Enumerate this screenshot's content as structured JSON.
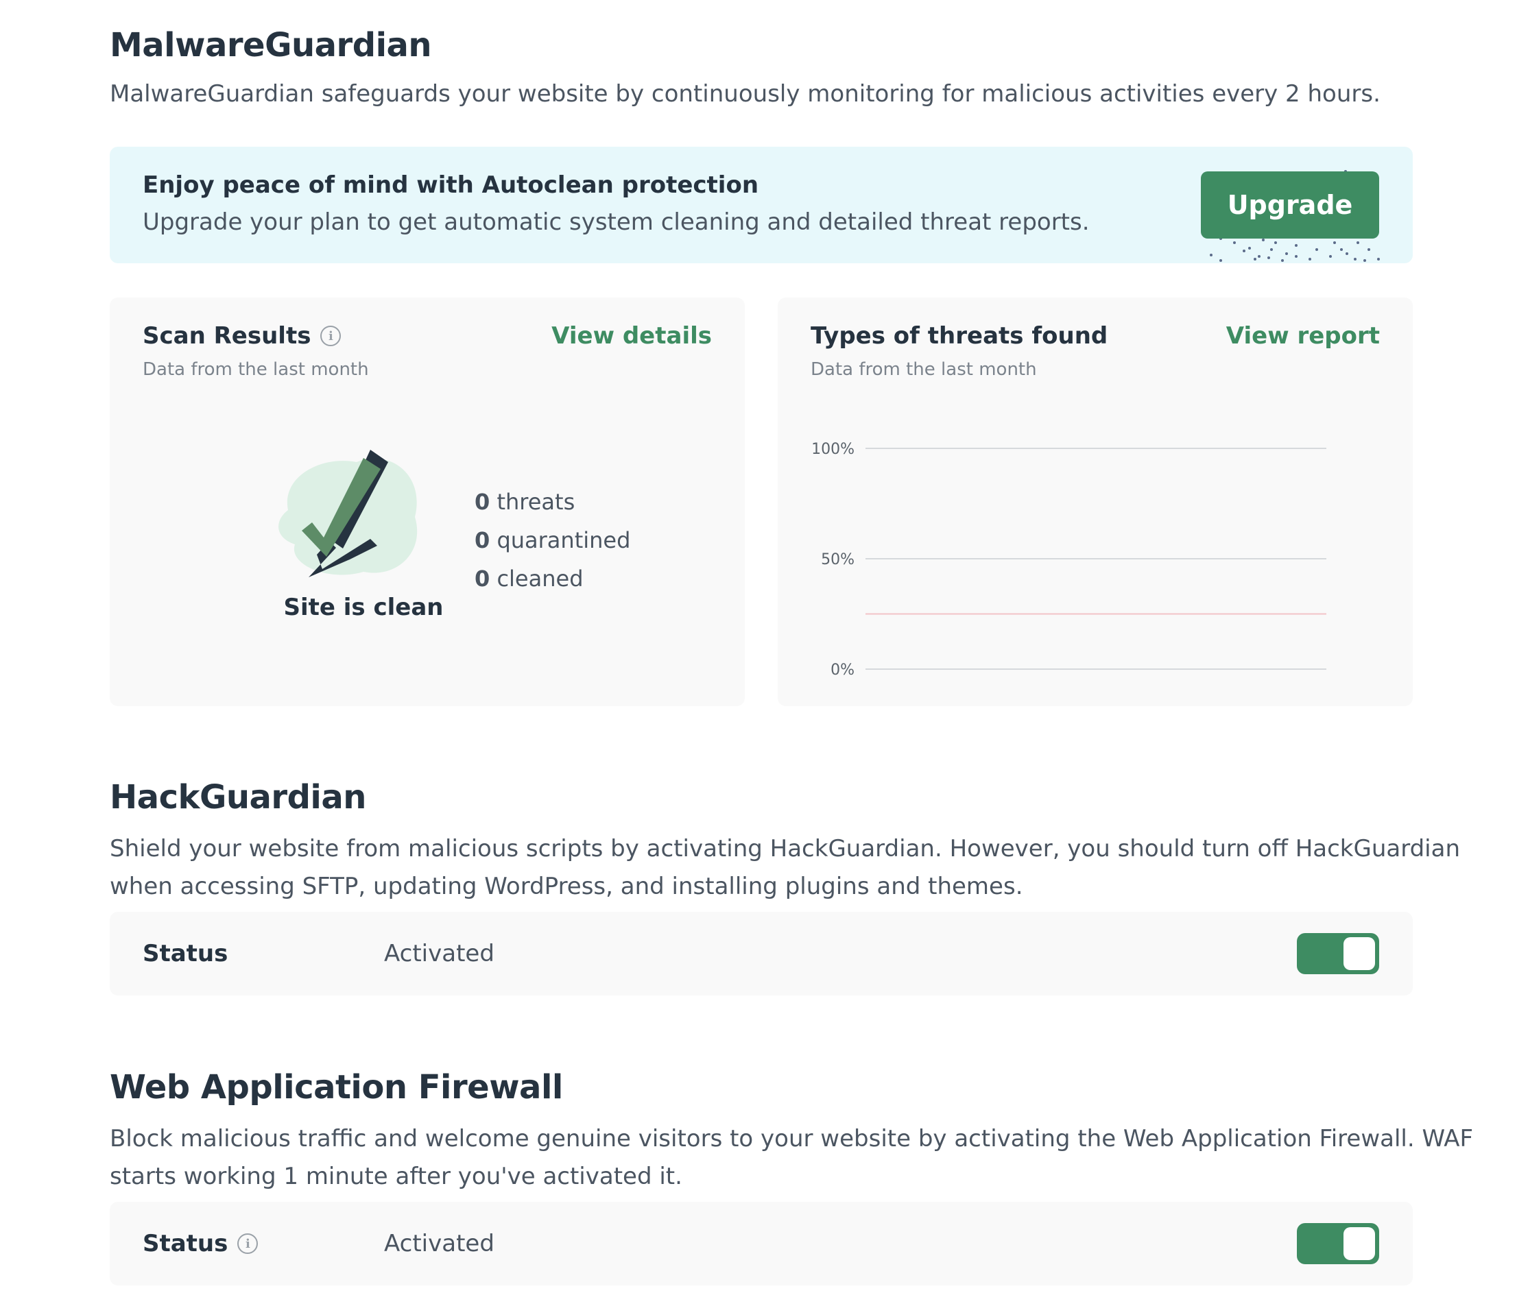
{
  "malware": {
    "title": "MalwareGuardian",
    "description": "MalwareGuardian safeguards your website by continuously monitoring for malicious activities every 2 hours."
  },
  "promo": {
    "title": "Enjoy peace of mind with Autoclean protection",
    "text": "Upgrade your plan to get automatic system cleaning and detailed threat reports.",
    "button": "Upgrade"
  },
  "scan": {
    "title": "Scan Results",
    "link": "View details",
    "subtitle": "Data from the last month",
    "status": "Site is clean",
    "threats_count": "0",
    "threats_label": "threats",
    "quarantined_count": "0",
    "quarantined_label": "quarantined",
    "cleaned_count": "0",
    "cleaned_label": "cleaned"
  },
  "threat_types": {
    "title": "Types of threats found",
    "link": "View report",
    "subtitle": "Data from the last month"
  },
  "chart_data": {
    "type": "line",
    "title": "Types of threats found",
    "yticks": [
      "100%",
      "50%",
      "0%"
    ],
    "ylim": [
      0,
      100
    ],
    "grid": true,
    "series": [
      {
        "values": [
          25,
          25
        ],
        "color": "#f2c4c8"
      }
    ]
  },
  "hackguardian": {
    "title": "HackGuardian",
    "description_line1": "Shield your website from malicious scripts by activating HackGuardian. However, you should turn off HackGuardian",
    "description_line2": "when accessing SFTP, updating WordPress, and installing plugins and themes.",
    "status_label": "Status",
    "status_value": "Activated",
    "enabled": true
  },
  "waf": {
    "title": "Web Application Firewall",
    "description_line1": "Block malicious traffic and welcome genuine visitors to your website by activating the Web Application Firewall. WAF",
    "description_line2": "starts working 1 minute after you've activated it.",
    "status_label": "Status",
    "status_value": "Activated",
    "enabled": true
  },
  "colors": {
    "accent": "#3e8c62",
    "banner_bg": "#e7f8fb",
    "card_bg": "#f9f9f9"
  }
}
